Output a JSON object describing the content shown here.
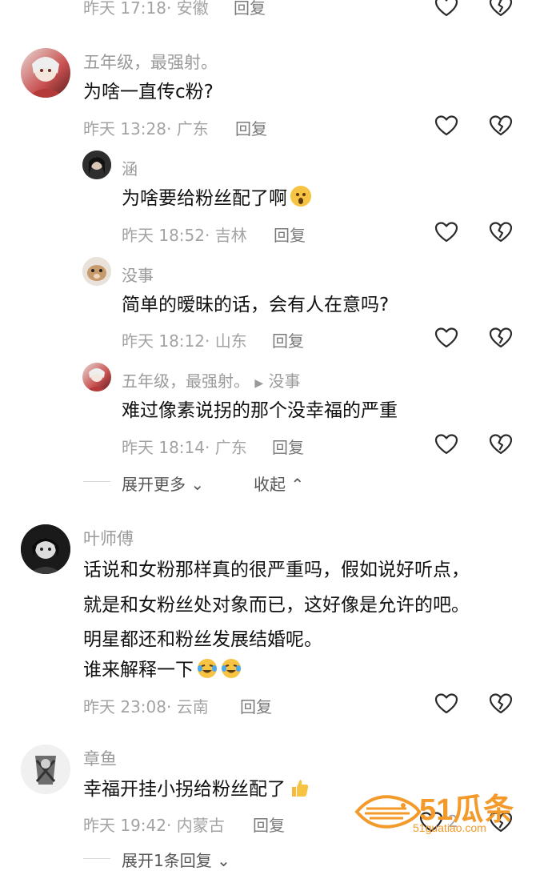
{
  "comments": [
    {
      "meta_time": "昨天 17:18",
      "meta_loc": "安徽",
      "reply": "回复"
    },
    {
      "username": "五年级，最强射。",
      "text": "为啥一直传c粉?",
      "meta_time": "昨天 13:28",
      "meta_loc": "广东",
      "reply": "回复"
    },
    {
      "username": "涵",
      "text": "为啥要给粉丝配了啊",
      "meta_time": "昨天 18:52",
      "meta_loc": "吉林",
      "reply": "回复"
    },
    {
      "username": "没事",
      "text": "简单的暧昧的话，会有人在意吗?",
      "meta_time": "昨天 18:12",
      "meta_loc": "山东",
      "reply": "回复"
    },
    {
      "username": "五年级，最强射。",
      "reply_to": "没事",
      "text": "难过像素说拐的那个没幸福的严重",
      "meta_time": "昨天 18:14",
      "meta_loc": "广东",
      "reply": "回复"
    },
    {
      "username": "叶师傅",
      "text_lines": [
        "话说和女粉那样真的很严重吗，假如说好听点，",
        "就是和女粉丝处对象而已，这好像是允许的吧。",
        "明星都还和粉丝发展结婚呢。",
        "谁来解释一下"
      ],
      "meta_time": "昨天 23:08",
      "meta_loc": "云南",
      "reply": "回复"
    },
    {
      "username": "章鱼",
      "text": "幸福开挂小拐给粉丝配了",
      "meta_time": "昨天 19:42",
      "meta_loc": "内蒙古",
      "reply": "回复"
    }
  ],
  "expand_more": "展开更多",
  "collapse": "收起",
  "expand_one": "展开1条回复",
  "like_count": "2",
  "watermark": {
    "brand": "51瓜条",
    "url": "51guatiao.com"
  },
  "icons": {
    "like": "heart-outline-icon",
    "dislike": "broken-heart-icon",
    "chevron_down": "chevron-down-icon",
    "chevron_up": "chevron-up-icon"
  },
  "colors": {
    "meta": "#a3a3a3",
    "username": "#9a9a9a",
    "watermark": "#f39a2a"
  }
}
